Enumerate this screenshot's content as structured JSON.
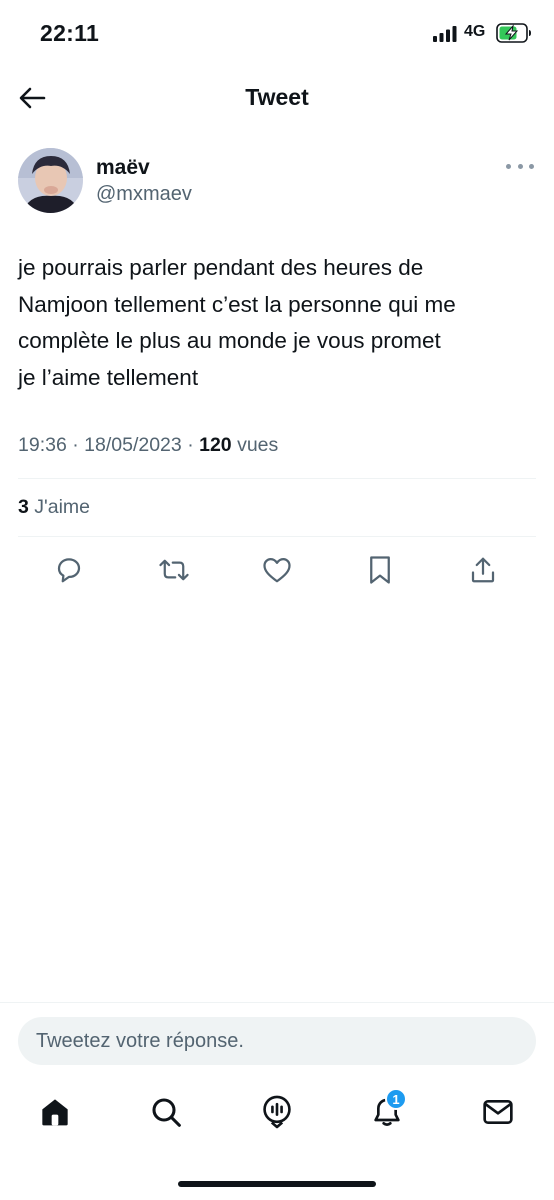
{
  "status_bar": {
    "time": "22:11",
    "network": "4G",
    "icons": [
      "signal-icon",
      "battery-charging-icon"
    ]
  },
  "header": {
    "title": "Tweet",
    "back_icon": "arrow-left-icon"
  },
  "tweet": {
    "author": {
      "display_name": "maëv",
      "handle": "@mxmaev"
    },
    "text_lines": [
      "je pourrais parler pendant des heures de",
      "Namjoon tellement c’est la personne qui me",
      "complète le plus au monde je vous promet",
      "je l’aime tellement"
    ],
    "time": "19:36",
    "date": "18/05/2023",
    "separator": "·",
    "views_count": "120",
    "views_label": "vues",
    "likes_count": "3",
    "likes_label": "J'aime"
  },
  "actions": [
    {
      "name": "reply-icon"
    },
    {
      "name": "retweet-icon"
    },
    {
      "name": "like-icon"
    },
    {
      "name": "bookmark-icon"
    },
    {
      "name": "share-icon"
    }
  ],
  "reply": {
    "placeholder": "Tweetez votre réponse."
  },
  "tab_bar": {
    "items": [
      "home-icon",
      "search-icon",
      "spaces-icon",
      "notifications-icon",
      "messages-icon"
    ],
    "notifications_badge": "1"
  },
  "colors": {
    "text": "#0f1419",
    "secondary": "#536471",
    "accent": "#1d9bf0",
    "divider": "#eff3f4",
    "input_bg": "#eff3f4"
  }
}
